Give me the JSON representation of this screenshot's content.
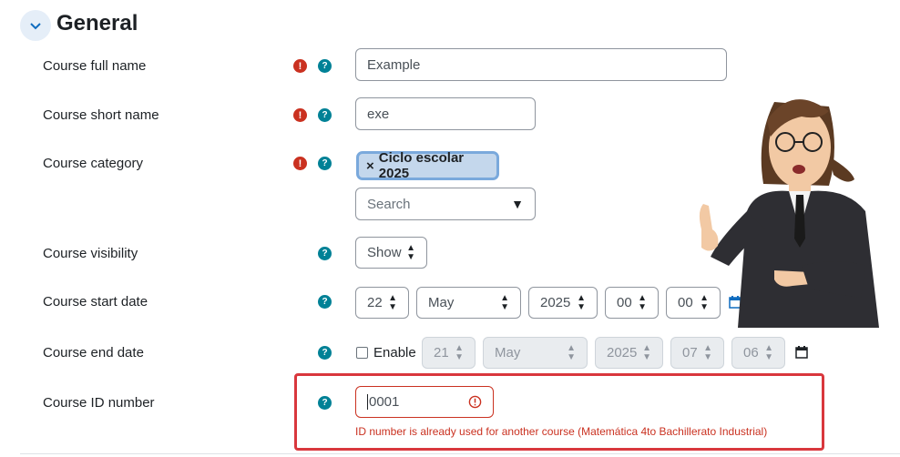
{
  "section": {
    "title": "General"
  },
  "fields": {
    "full_name": {
      "label": "Course full name",
      "value": "Example"
    },
    "short_name": {
      "label": "Course short name",
      "value": "exe"
    },
    "category": {
      "label": "Course category",
      "selected": "Ciclo escolar 2025",
      "chip_remove": "×",
      "search_placeholder": "Search"
    },
    "visibility": {
      "label": "Course visibility",
      "value": "Show"
    },
    "start_date": {
      "label": "Course start date",
      "day": "22",
      "month": "May",
      "year": "2025",
      "hour": "00",
      "minute": "00"
    },
    "end_date": {
      "label": "Course end date",
      "enable_label": "Enable",
      "day": "21",
      "month": "May",
      "year": "2025",
      "hour": "07",
      "minute": "06"
    },
    "id_number": {
      "label": "Course ID number",
      "value": "0001",
      "error": "ID number is already used for another course (Matemática 4to Bachillerato Industrial)"
    }
  },
  "icons": {
    "required": "!",
    "help": "?",
    "dropdown": "▼"
  },
  "colors": {
    "required": "#ca3120",
    "help": "#008196",
    "error_border": "#d9373d",
    "chip_bg": "#c4d7ec"
  }
}
